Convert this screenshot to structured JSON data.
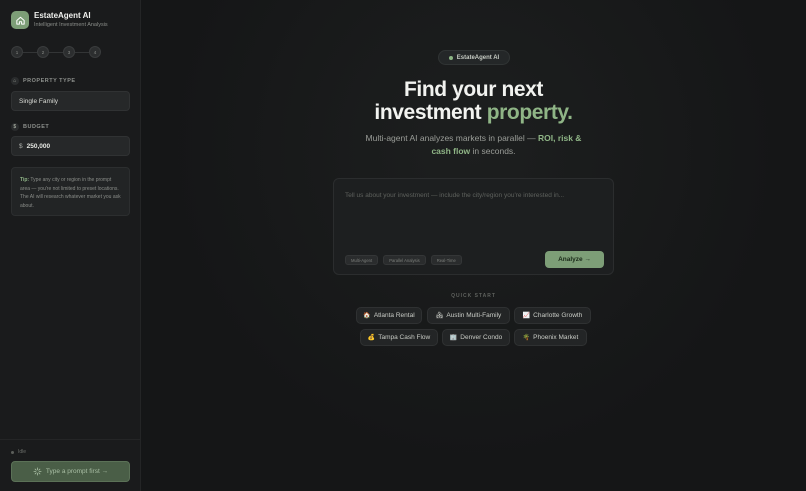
{
  "sidebar": {
    "brand": {
      "name": "EstateAgent AI",
      "subtitle": "Intelligent Investment Analysis"
    },
    "steps": [
      "1",
      "2",
      "3",
      "4"
    ],
    "property_type": {
      "label": "PROPERTY TYPE",
      "value": "Single Family"
    },
    "budget": {
      "label": "BUDGET",
      "currency": "$",
      "value": "250,000"
    },
    "tip": {
      "title": "Tip:",
      "text": "Type any city or region in the prompt area — you're not limited to preset locations. The AI will research whatever market you ask about."
    },
    "status": "Idle",
    "prompt_button": "Type a prompt first →"
  },
  "main": {
    "badge": "EstateAgent AI",
    "hero_line1": "Find your next",
    "hero_line2_white": "investment",
    "hero_line2_green": "property.",
    "subtitle": {
      "part1": "Multi-agent AI analyzes markets in parallel — ",
      "highlight1": "ROI, risk &",
      "highlight2": "cash flow",
      "part2": " in seconds."
    },
    "composer": {
      "placeholder": "Tell us about your investment — include the city/region you're interested in...",
      "chips": [
        "Multi-Agent",
        "Parallel Analysis",
        "Real-Time"
      ],
      "analyze_label": "Analyze →"
    },
    "quick_start": {
      "label": "QUICK START",
      "items": [
        {
          "icon": "🏠",
          "label": "Atlanta Rental"
        },
        {
          "icon": "🏘",
          "label": "Austin Multi-Family"
        },
        {
          "icon": "📈",
          "label": "Charlotte Growth"
        },
        {
          "icon": "💰",
          "label": "Tampa Cash Flow"
        },
        {
          "icon": "🏢",
          "label": "Denver Condo"
        },
        {
          "icon": "🌴",
          "label": "Phoenix Market"
        }
      ]
    }
  },
  "colors": {
    "accent": "#7d9e77",
    "accent_text": "#8fb586",
    "background": "#141516"
  }
}
